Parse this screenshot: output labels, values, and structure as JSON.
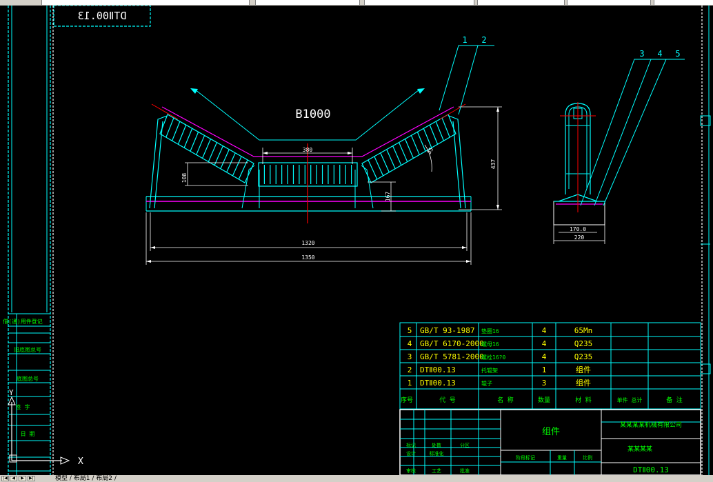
{
  "title_stamp": "DTⅡ00.13",
  "drawing": {
    "label_b": "B1000",
    "dims": {
      "d380": "380",
      "d437": "437",
      "d108": "108",
      "d167": "167",
      "d35": "35",
      "d1320": "1320",
      "d1350": "1350",
      "d170": "170.0",
      "d220": "220"
    },
    "callouts_front": [
      "1",
      "2"
    ],
    "callouts_side": [
      "3",
      "4",
      "5"
    ]
  },
  "bom": {
    "rows": [
      {
        "no": "5",
        "code": "GB/T 93-1987",
        "name": "垫圈16",
        "qty": "4",
        "material": "65Mn"
      },
      {
        "no": "4",
        "code": "GB/T 6170-2000",
        "name": "螺母16",
        "qty": "4",
        "material": "Q235"
      },
      {
        "no": "3",
        "code": "GB/T 5781-2000",
        "name": "螺栓16?0",
        "qty": "4",
        "material": "Q235"
      },
      {
        "no": "2",
        "code": "DTⅡ00.13",
        "name": "托辊架",
        "qty": "1",
        "material": "组件"
      },
      {
        "no": "1",
        "code": "DTⅡ00.13",
        "name": "辊子",
        "qty": "3",
        "material": "组件"
      }
    ],
    "header": {
      "no": "序号",
      "code": "代 号",
      "name": "名 称",
      "qty": "数量",
      "material": "材 料",
      "weight": "单件 总计",
      "note": "备 注"
    }
  },
  "title_block": {
    "part_name": "组件",
    "company": "某某某某机械有限公司",
    "company2": "某某某某",
    "drawing_no": "DTⅡ00.13",
    "cells": [
      "标记",
      "处数",
      "分区",
      "设计",
      "标准化",
      "审核",
      "工艺",
      "批准",
      "阶段标记",
      "重量",
      "比例"
    ]
  },
  "left_panel": {
    "labels": [
      "借(通)用件登记",
      "旧底图总号",
      "底图总号",
      "签 字",
      "日 期"
    ]
  },
  "ucs": {
    "x": "X",
    "y": "Y"
  },
  "status_bar": {
    "nav": [
      "|◀",
      "◀",
      "▶",
      "▶|"
    ],
    "tabs": "模型 / 布局1 / 布局2 /"
  },
  "colors": {
    "background": "#000000",
    "border": "#00ffff",
    "frame": "#ffffff",
    "title_text": "#00ff00",
    "geometry": "#00ffff",
    "centerline": "#ff0000",
    "belt": "#ff00ff",
    "dimension": "#ffffff",
    "text": "#ffff00"
  }
}
